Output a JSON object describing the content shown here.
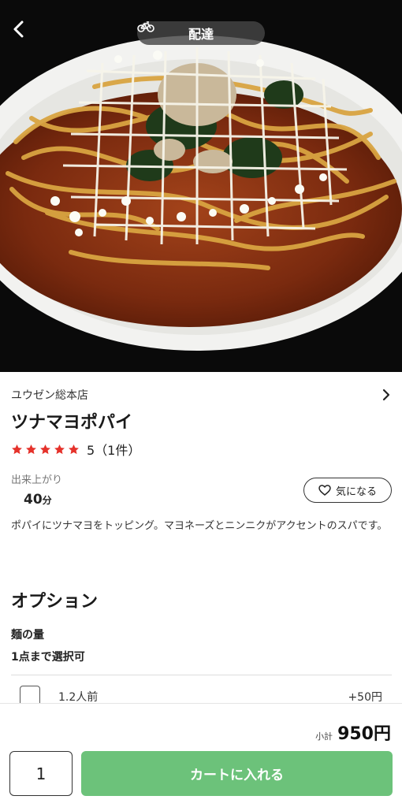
{
  "header": {
    "back_icon": "chevron-left-icon",
    "mode_icon": "bicycle-icon",
    "mode_label": "配達"
  },
  "store": {
    "name": "ユウゼン総本店",
    "chevron_icon": "chevron-right-icon"
  },
  "item": {
    "title": "ツナマヨポパイ",
    "rating_value": 5,
    "rating_text": "5（1件）",
    "star_color": "#e5322b",
    "prep_label": "出来上がり",
    "prep_number": "40",
    "prep_unit": "分",
    "favorite_label": "気になる",
    "favorite_icon": "heart-outline-icon",
    "description": "ポパイにツナマヨをトッピング。マヨネーズとニンニクがアクセントのスパです。"
  },
  "options": {
    "section_title": "オプション",
    "groups": [
      {
        "name": "麺の量",
        "rule": "1点まで選択可",
        "choices": [
          {
            "label": "1.2人前",
            "price": "+50円",
            "checked": false
          }
        ]
      }
    ]
  },
  "footer": {
    "subtotal_label": "小計",
    "subtotal_value": "950円",
    "quantity": "1",
    "add_to_cart_label": "カートに入れる",
    "accent_color": "#6cc27a"
  }
}
